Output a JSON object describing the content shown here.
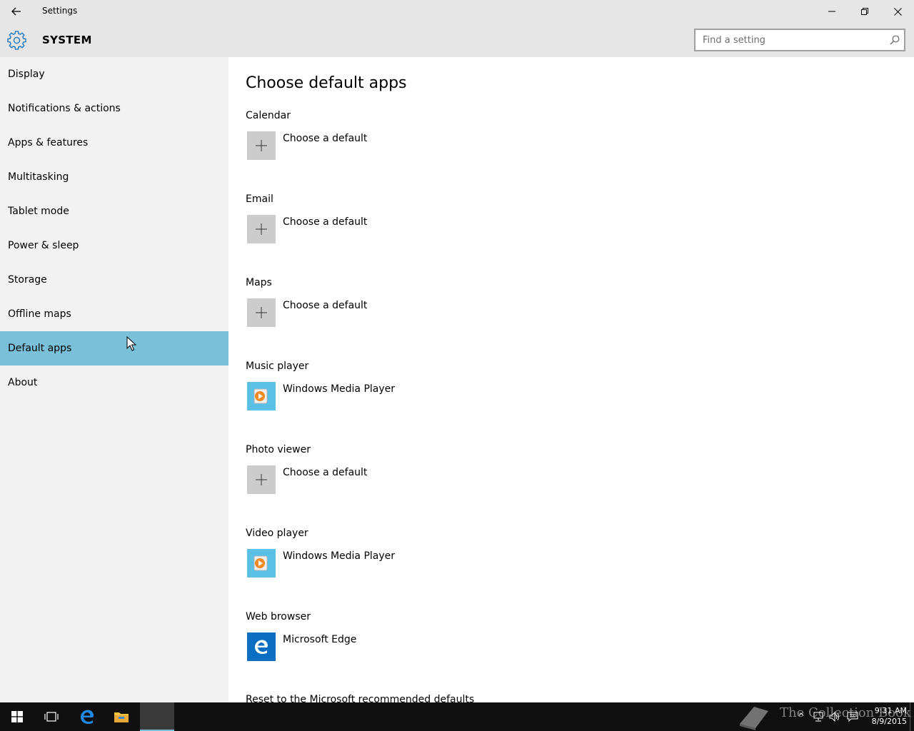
{
  "window": {
    "title": "Settings"
  },
  "header": {
    "section_title": "SYSTEM",
    "search_placeholder": "Find a setting"
  },
  "sidebar": {
    "selected_index": 8,
    "items": [
      {
        "label": "Display"
      },
      {
        "label": "Notifications & actions"
      },
      {
        "label": "Apps & features"
      },
      {
        "label": "Multitasking"
      },
      {
        "label": "Tablet mode"
      },
      {
        "label": "Power & sleep"
      },
      {
        "label": "Storage"
      },
      {
        "label": "Offline maps"
      },
      {
        "label": "Default apps"
      },
      {
        "label": "About"
      }
    ]
  },
  "main": {
    "title": "Choose default apps",
    "sections": [
      {
        "label": "Calendar",
        "app": "Choose a default",
        "icon": "plus-icon"
      },
      {
        "label": "Email",
        "app": "Choose a default",
        "icon": "plus-icon"
      },
      {
        "label": "Maps",
        "app": "Choose a default",
        "icon": "plus-icon"
      },
      {
        "label": "Music player",
        "app": "Windows Media Player",
        "icon": "windows-media-player-icon"
      },
      {
        "label": "Photo viewer",
        "app": "Choose a default",
        "icon": "plus-icon"
      },
      {
        "label": "Video player",
        "app": "Windows Media Player",
        "icon": "windows-media-player-icon"
      },
      {
        "label": "Web browser",
        "app": "Microsoft Edge",
        "icon": "microsoft-edge-icon"
      }
    ],
    "reset_label": "Reset to the Microsoft recommended defaults"
  },
  "taskbar": {
    "time": "9:31 AM",
    "date": "8/9/2015",
    "watermark": "The Collection Book"
  },
  "colors": {
    "accent": "#7ac0d9",
    "titlebar": "#e6e6e6",
    "sidebar": "#f2f2f2",
    "taskbar": "#101010",
    "edge_blue": "#0a6fc2",
    "wmp_tile": "#5bc0e6"
  }
}
